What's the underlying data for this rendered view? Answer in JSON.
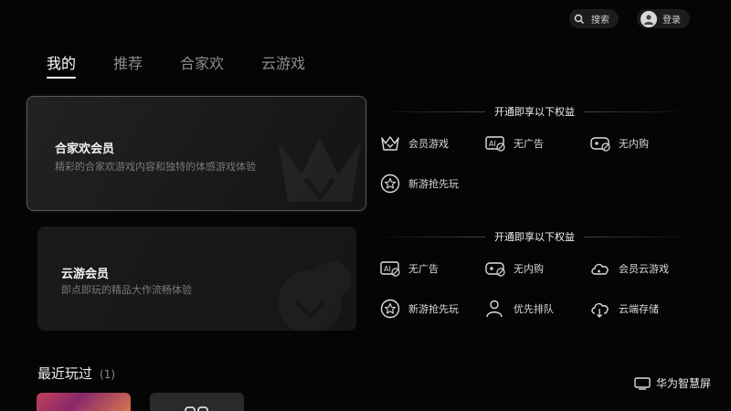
{
  "topbar": {
    "search_label": "搜索",
    "login_label": "登录"
  },
  "tabs": [
    {
      "label": "我的",
      "active": true
    },
    {
      "label": "推荐",
      "active": false
    },
    {
      "label": "合家欢",
      "active": false
    },
    {
      "label": "云游戏",
      "active": false
    }
  ],
  "cards": [
    {
      "title": "合家欢会员",
      "desc": "精彩的合家欢游戏内容和独特的体感游戏体验"
    },
    {
      "title": "云游会员",
      "desc": "即点即玩的精品大作流畅体验"
    }
  ],
  "section1": {
    "heading": "开通即享以下权益",
    "benefits": [
      {
        "label": "会员游戏",
        "icon": "crown-icon"
      },
      {
        "label": "无广告",
        "icon": "no-ads-icon"
      },
      {
        "label": "无内购",
        "icon": "no-purchase-icon"
      },
      {
        "label": "新游抢先玩",
        "icon": "star-icon"
      }
    ]
  },
  "section2": {
    "heading": "开通即享以下权益",
    "benefits": [
      {
        "label": "无广告",
        "icon": "no-ads-icon"
      },
      {
        "label": "无内购",
        "icon": "no-purchase-icon"
      },
      {
        "label": "会员云游戏",
        "icon": "cloud-game-icon"
      },
      {
        "label": "新游抢先玩",
        "icon": "star-icon"
      },
      {
        "label": "优先排队",
        "icon": "person-priority-icon"
      },
      {
        "label": "云端存储",
        "icon": "cloud-storage-icon"
      }
    ]
  },
  "recent": {
    "title": "最近玩过",
    "count": "(1)"
  },
  "brand": {
    "label": "华为智慧屏"
  }
}
